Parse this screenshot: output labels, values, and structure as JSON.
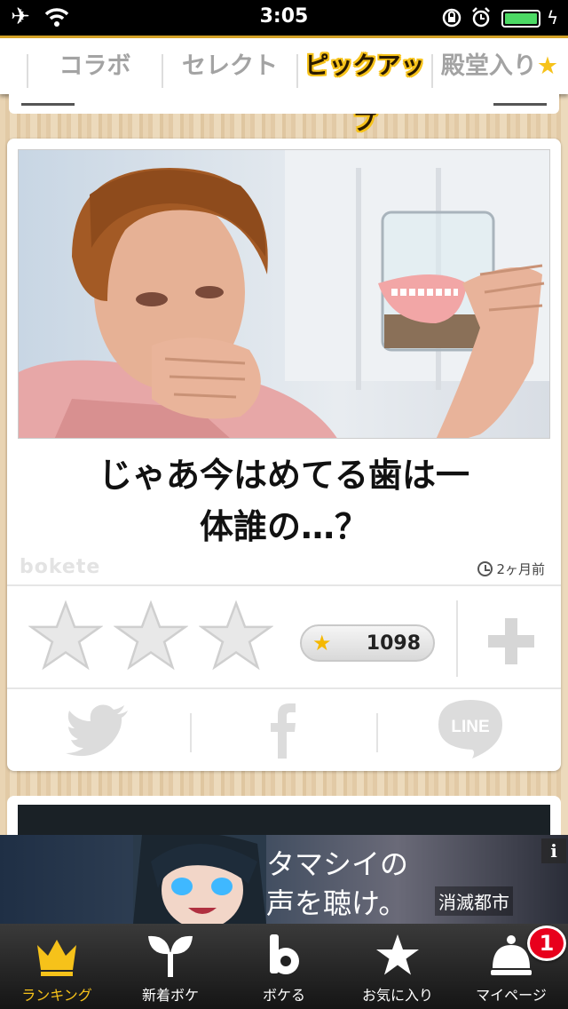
{
  "status_bar": {
    "time": "3:05"
  },
  "tabs": [
    {
      "label": "コラボ"
    },
    {
      "label": "セレクト"
    },
    {
      "label": "ピックアップ",
      "selected": true
    },
    {
      "label": "殿堂入り",
      "suffix": "★"
    }
  ],
  "post": {
    "caption_line1": "じゃあ今はめてる歯は一",
    "caption_line2": "体誰の…？",
    "watermark": "bokete",
    "time_ago": "2ヶ月前",
    "score": "1098",
    "stars_available": 3
  },
  "share": {
    "line_label": "LINE",
    "facebook_label": "f"
  },
  "ad": {
    "line1": "タマシイの",
    "line2": "声を聴け。",
    "badge": "消滅都市",
    "info": "i"
  },
  "bottom_nav": [
    {
      "label": "ランキング",
      "selected": true
    },
    {
      "label": "新着ボケ"
    },
    {
      "label": "ボケる"
    },
    {
      "label": "お気に入り"
    },
    {
      "label": "マイページ",
      "badge": "1"
    }
  ],
  "colors": {
    "accent": "#f6c21a",
    "badge": "#e8001c"
  }
}
